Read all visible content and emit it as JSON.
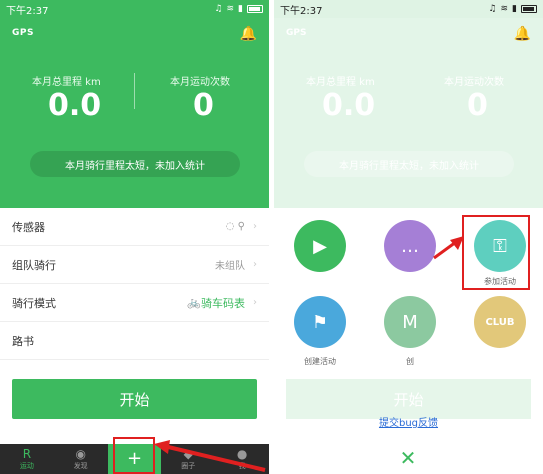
{
  "status": {
    "time": "下午2:37"
  },
  "left": {
    "logo": "GPS",
    "stats": [
      {
        "label": "本月总里程 km",
        "value": "0.0"
      },
      {
        "label": "本月运动次数",
        "value": "0"
      }
    ],
    "notice": "本月骑行里程太短，未加入统计",
    "rows": [
      {
        "label": "传感器",
        "value": ""
      },
      {
        "label": "组队骑行",
        "value": "未组队"
      },
      {
        "label": "骑行模式",
        "value": "骑车码表"
      },
      {
        "label": "路书",
        "value": ""
      }
    ],
    "start_label": "开始",
    "tabs": [
      {
        "label": "运动",
        "icon": "R"
      },
      {
        "label": "发现",
        "icon": "◉"
      },
      {
        "label": "",
        "icon": "+"
      },
      {
        "label": "圈子",
        "icon": "◆"
      },
      {
        "label": "我",
        "icon": "●"
      }
    ]
  },
  "right": {
    "actions": [
      {
        "label": "",
        "color": "#3dba5f",
        "icon": "▶"
      },
      {
        "label": "",
        "color": "#a57fd6",
        "icon": "…"
      },
      {
        "label": "参加活动",
        "color": "#5ecfbf",
        "icon": "⚿"
      },
      {
        "label": "创建活动",
        "color": "#4aa8dc",
        "icon": "⚑"
      },
      {
        "label": "创",
        "color": "#8cc9a0",
        "icon": "M"
      },
      {
        "label": "",
        "color": "#e2c87a",
        "icon": "CLUB"
      }
    ],
    "start_label": "开始",
    "feedback": "提交bug反馈",
    "close": "✕"
  }
}
